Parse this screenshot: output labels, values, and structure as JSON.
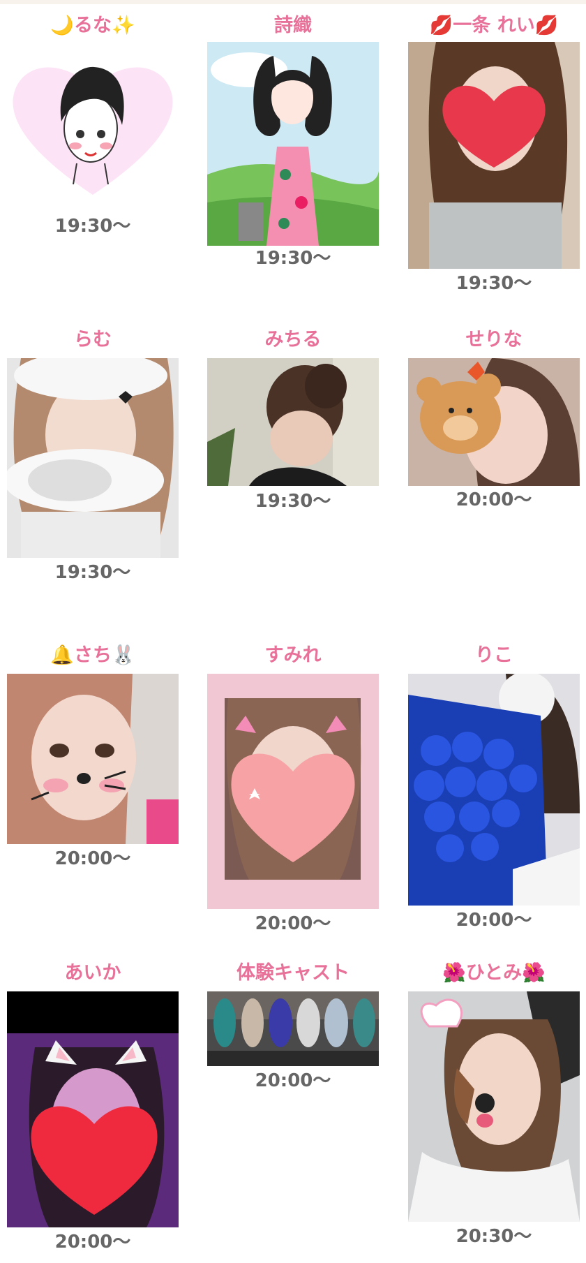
{
  "casts": [
    {
      "name": "🌙るな✨",
      "time": "19:30〜",
      "photo": "illustration-heart"
    },
    {
      "name": "詩織",
      "time": "19:30〜",
      "photo": "illustration-outdoor"
    },
    {
      "name": "💋一条 れい💋",
      "time": "19:30〜",
      "photo": "photo-heart-sticker"
    },
    {
      "name": "らむ",
      "time": "19:30〜",
      "photo": "photo-cloud-sticker"
    },
    {
      "name": "みちる",
      "time": "19:30〜",
      "photo": "photo-side-profile"
    },
    {
      "name": "せりな",
      "time": "20:00〜",
      "photo": "photo-bear-sticker"
    },
    {
      "name": "🔔さち🐰",
      "time": "20:00〜",
      "photo": "photo-cat-filter"
    },
    {
      "name": "すみれ",
      "time": "20:00〜",
      "photo": "photo-peach-sticker"
    },
    {
      "name": "りこ",
      "time": "20:00〜",
      "photo": "photo-blue-roses"
    },
    {
      "name": "あいか",
      "time": "20:00〜",
      "photo": "photo-cat-ears-heart"
    },
    {
      "name": "体験キャスト",
      "time": "20:00〜",
      "photo": "photo-group"
    },
    {
      "name": "🌺ひとみ🌺",
      "time": "20:30〜",
      "photo": "photo-dog-filter"
    }
  ],
  "colors": {
    "name": "#e8719a",
    "time": "#666666",
    "topbar": "#f7f3ec"
  }
}
